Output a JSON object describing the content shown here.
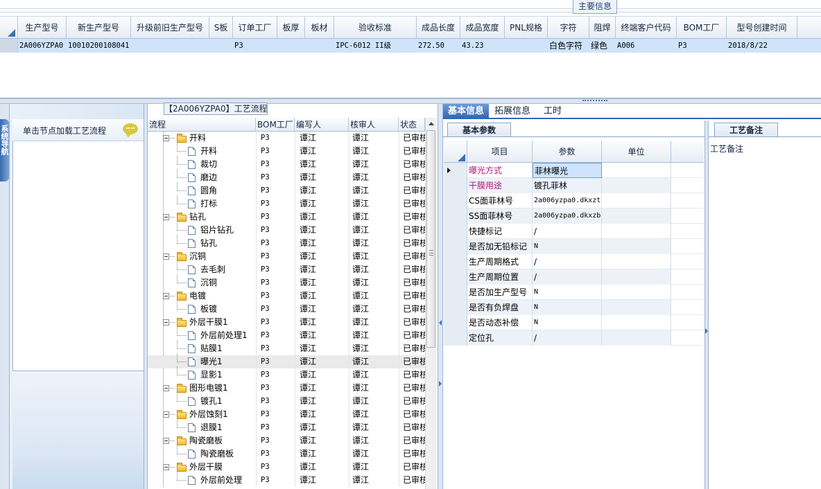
{
  "top": {
    "main_info_tab": "主要信息"
  },
  "product_grid": {
    "columns": [
      "生产型号",
      "新生产型号",
      "升级前旧生产型号",
      "S板",
      "订单工厂",
      "板厚",
      "板材",
      "验收标准",
      "成品长度",
      "成品宽度",
      "PNL规格",
      "字符",
      "阻焊",
      "终端客户代码",
      "BOM工厂",
      "型号创建时间"
    ],
    "row": [
      "2A006YZPA0",
      "10010200108041",
      "",
      "",
      "P3",
      "",
      "",
      "IPC-6012 II级",
      "272.50",
      "43.23",
      "",
      "白色字符",
      "绿色",
      "A006",
      "P3",
      "2018/8/22"
    ]
  },
  "nav": {
    "strip_label": "系统导航",
    "hint": "单击节点加载工艺流程"
  },
  "flow": {
    "title": "【2A006YZPA0】工艺流程",
    "columns": [
      "流程",
      "BOM工厂",
      "编写人",
      "核审人",
      "状态"
    ],
    "rows": [
      {
        "name": "开料",
        "level": 0,
        "bom": "P3",
        "writer": "谭江",
        "reviewer": "谭江",
        "status": "已审核"
      },
      {
        "name": "开料",
        "level": 1,
        "bom": "P3",
        "writer": "谭江",
        "reviewer": "谭江",
        "status": "已审核"
      },
      {
        "name": "裁切",
        "level": 1,
        "bom": "P3",
        "writer": "谭江",
        "reviewer": "谭江",
        "status": "已审核"
      },
      {
        "name": "磨边",
        "level": 1,
        "bom": "P3",
        "writer": "谭江",
        "reviewer": "谭江",
        "status": "已审核"
      },
      {
        "name": "圆角",
        "level": 1,
        "bom": "P3",
        "writer": "谭江",
        "reviewer": "谭江",
        "status": "已审核"
      },
      {
        "name": "打标",
        "level": 1,
        "bom": "P3",
        "writer": "谭江",
        "reviewer": "谭江",
        "status": "已审核"
      },
      {
        "name": "钻孔",
        "level": 0,
        "bom": "P3",
        "writer": "谭江",
        "reviewer": "谭江",
        "status": "已审核"
      },
      {
        "name": "铝片钻孔",
        "level": 1,
        "bom": "P3",
        "writer": "谭江",
        "reviewer": "谭江",
        "status": "已审核"
      },
      {
        "name": "钻孔",
        "level": 1,
        "bom": "P3",
        "writer": "谭江",
        "reviewer": "谭江",
        "status": "已审核"
      },
      {
        "name": "沉铜",
        "level": 0,
        "bom": "P3",
        "writer": "谭江",
        "reviewer": "谭江",
        "status": "已审核"
      },
      {
        "name": "去毛刺",
        "level": 1,
        "bom": "P3",
        "writer": "谭江",
        "reviewer": "谭江",
        "status": "已审核"
      },
      {
        "name": "沉铜",
        "level": 1,
        "bom": "P3",
        "writer": "谭江",
        "reviewer": "谭江",
        "status": "已审核"
      },
      {
        "name": "电镀",
        "level": 0,
        "bom": "P3",
        "writer": "谭江",
        "reviewer": "谭江",
        "status": "已审核"
      },
      {
        "name": "板镀",
        "level": 1,
        "bom": "P3",
        "writer": "谭江",
        "reviewer": "谭江",
        "status": "已审核"
      },
      {
        "name": "外层干膜1",
        "level": 0,
        "bom": "P3",
        "writer": "谭江",
        "reviewer": "谭江",
        "status": "已审核"
      },
      {
        "name": "外层前处理1",
        "level": 1,
        "bom": "P3",
        "writer": "谭江",
        "reviewer": "谭江",
        "status": "已审核"
      },
      {
        "name": "贴膜1",
        "level": 1,
        "bom": "P3",
        "writer": "谭江",
        "reviewer": "谭江",
        "status": "已审核"
      },
      {
        "name": "曝光1",
        "level": 1,
        "bom": "P3",
        "writer": "谭江",
        "reviewer": "谭江",
        "status": "已审核",
        "selected": true
      },
      {
        "name": "显影1",
        "level": 1,
        "bom": "P3",
        "writer": "谭江",
        "reviewer": "谭江",
        "status": "已审核"
      },
      {
        "name": "图形电镀1",
        "level": 0,
        "bom": "P3",
        "writer": "谭江",
        "reviewer": "谭江",
        "status": "已审核"
      },
      {
        "name": "镀孔1",
        "level": 1,
        "bom": "P3",
        "writer": "谭江",
        "reviewer": "谭江",
        "status": "已审核"
      },
      {
        "name": "外层蚀刻1",
        "level": 0,
        "bom": "P3",
        "writer": "谭江",
        "reviewer": "谭江",
        "status": "已审核"
      },
      {
        "name": "退膜1",
        "level": 1,
        "bom": "P3",
        "writer": "谭江",
        "reviewer": "谭江",
        "status": "已审核"
      },
      {
        "name": "陶瓷磨板",
        "level": 0,
        "bom": "P3",
        "writer": "谭江",
        "reviewer": "谭江",
        "status": "已审核"
      },
      {
        "name": "陶瓷磨板",
        "level": 1,
        "bom": "P3",
        "writer": "谭江",
        "reviewer": "谭江",
        "status": "已审核"
      },
      {
        "name": "外层干膜",
        "level": 0,
        "bom": "P3",
        "writer": "谭江",
        "reviewer": "谭江",
        "status": "已审核"
      },
      {
        "name": "外层前处理",
        "level": 1,
        "bom": "P3",
        "writer": "谭江",
        "reviewer": "谭江",
        "status": "已审核"
      }
    ]
  },
  "right_tabs": [
    "基本信息",
    "拓展信息",
    "工时"
  ],
  "basic": {
    "tab": "基本参数",
    "columns": [
      "项目",
      "参数",
      "单位"
    ],
    "rows": [
      {
        "key": "曝光方式",
        "value": "菲林曝光",
        "highlight": true,
        "current": true
      },
      {
        "key": "干膜用途",
        "value": "镀孔菲林",
        "highlight": true
      },
      {
        "key": "CS面菲林号",
        "value": "2a006yzpa0.dkxzt",
        "mono": true
      },
      {
        "key": "SS面菲林号",
        "value": "2a006yzpa0.dkxzb",
        "mono": true
      },
      {
        "key": "快捷标记",
        "value": "/"
      },
      {
        "key": "是否加无铅标记",
        "value": "N",
        "mono": true
      },
      {
        "key": "生产周期格式",
        "value": "/"
      },
      {
        "key": "生产周期位置",
        "value": "/"
      },
      {
        "key": "是否加生产型号",
        "value": "N",
        "mono": true
      },
      {
        "key": "是否有负焊盘",
        "value": "N",
        "mono": true
      },
      {
        "key": "是否动态补偿",
        "value": "N",
        "mono": true
      },
      {
        "key": "定位孔",
        "value": "/"
      }
    ]
  },
  "notes": {
    "tab": "工艺备注",
    "label": "工艺备注"
  }
}
